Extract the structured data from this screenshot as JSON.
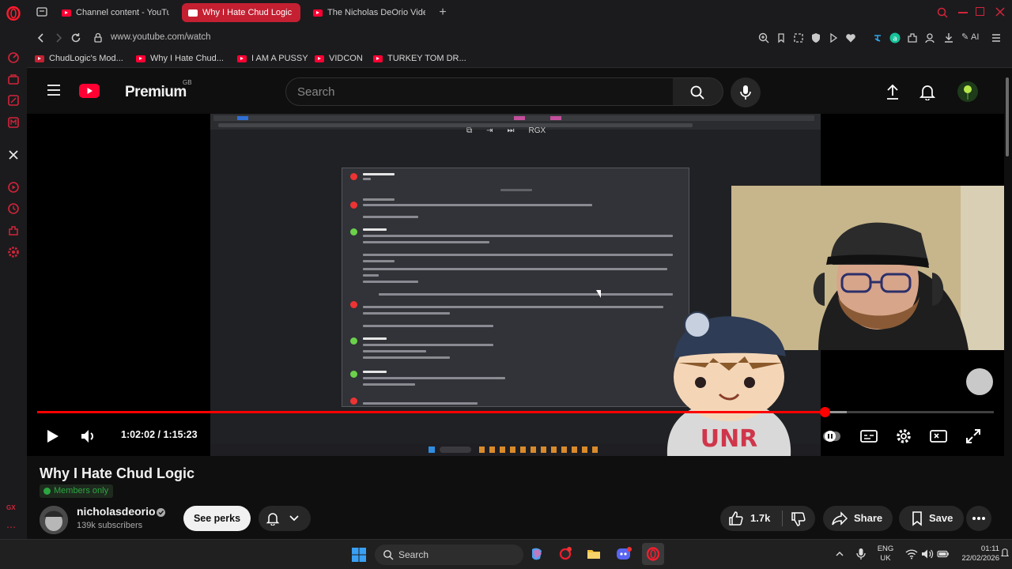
{
  "browser": {
    "tabs": [
      {
        "label": "Channel content - YouTube",
        "active": false
      },
      {
        "label": "Why I Hate Chud Logic - YouTube",
        "active": true
      },
      {
        "label": "The Nicholas DeOrio Video",
        "active": false
      }
    ],
    "url": "www.youtube.com/watch",
    "ai_label": "AI",
    "bookmarks": [
      {
        "label": "ChudLogic's Mod..."
      },
      {
        "label": "Why I Hate Chud..."
      },
      {
        "label": "I AM A PUSSY"
      },
      {
        "label": "VIDCON"
      },
      {
        "label": "TURKEY TOM DR..."
      }
    ]
  },
  "youtube": {
    "logo_text": "Premium",
    "region": "GB",
    "search_placeholder": "Search"
  },
  "player": {
    "time_current": "1:02:02",
    "time_total": "1:15:23",
    "time_display": "1:02:02 / 1:15:23",
    "progress_fraction": 0.823,
    "buffer_fraction": 0.846,
    "overlay_label": "RGX",
    "sticker_text": "UNR",
    "state": "paused"
  },
  "video": {
    "title": "Why I Hate Chud Logic",
    "members_badge": "Members only",
    "channel_name": "nicholasdeorio",
    "subscribers": "139k subscribers",
    "see_perks_label": "See perks",
    "likes": "1.7k",
    "share_label": "Share",
    "save_label": "Save"
  },
  "taskbar": {
    "search_label": "Search",
    "lang_top": "ENG",
    "lang_bottom": "UK",
    "time": "01:11",
    "date": "22/02/2026"
  },
  "colors": {
    "opera_red": "#d3243a",
    "youtube_red": "#ff0033",
    "members_green": "#2ba640",
    "background": "#0f0f0f"
  },
  "icons": {
    "sidebar": [
      "opera-logo-icon",
      "speed-dial-icon",
      "workspace-icon",
      "pinboard-icon",
      "messenger-icon",
      "x-twitter-icon",
      "player-icon",
      "history-icon",
      "extensions-icon",
      "settings-icon",
      "gx-icon",
      "more-icon"
    ]
  }
}
